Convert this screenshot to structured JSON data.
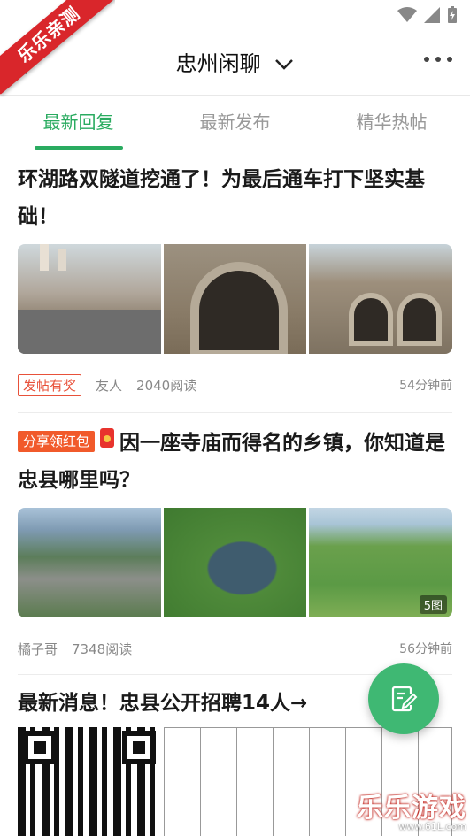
{
  "watermark": {
    "ribbon": "乐乐亲测",
    "brand": "乐乐游戏",
    "site": "www.61L.com"
  },
  "header": {
    "title": "忠州闲聊"
  },
  "tabs": [
    {
      "label": "最新回复",
      "active": true
    },
    {
      "label": "最新发布",
      "active": false
    },
    {
      "label": "精华热帖",
      "active": false
    }
  ],
  "posts": [
    {
      "title": "环湖路双隧道挖通了！为最后通车打下坚实基础！",
      "badge": "发帖有奖",
      "author": "友人",
      "reads": "2040阅读",
      "time": "54分钟前"
    },
    {
      "badge": "分享领红包",
      "title": "因一座寺庙而得名的乡镇，你知道是忠县哪里吗？",
      "image_count": "5图",
      "author": "橘子哥",
      "reads": "7348阅读",
      "time": "56分钟前"
    },
    {
      "title": "最新消息！忠县公开招聘14人→"
    }
  ],
  "colors": {
    "accent": "#2aab60",
    "fab": "#3fb873",
    "ribbon": "#d9262b",
    "badge": "#f15a2b"
  },
  "icons": {
    "back": "back-arrow-icon",
    "chevron": "chevron-down-icon",
    "more": "more-dots-icon",
    "fab": "compose-icon"
  }
}
